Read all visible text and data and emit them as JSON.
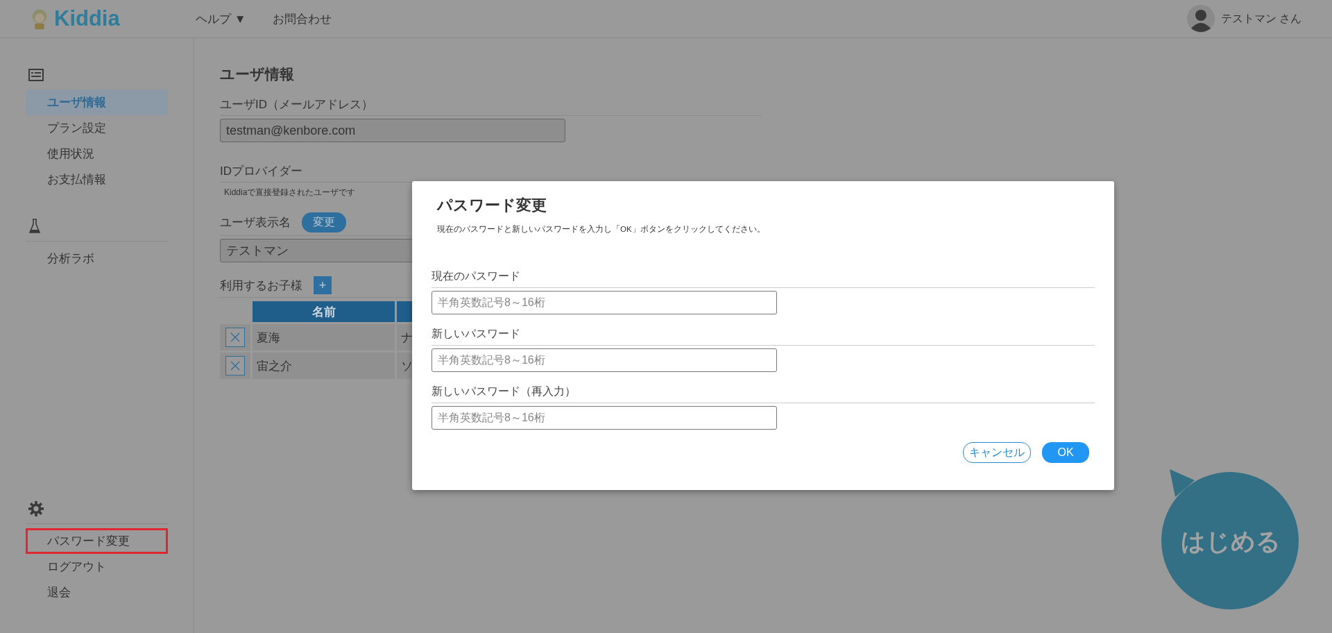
{
  "header": {
    "logo": "Kiddia",
    "nav": [
      {
        "label": "ヘルプ ▼"
      },
      {
        "label": "お問合わせ"
      }
    ],
    "user": "テストマン さん"
  },
  "sidebar": {
    "groups": [
      {
        "kind": "list",
        "items": [
          {
            "label": "ユーザ情報",
            "selected": true,
            "highlighted": false
          },
          {
            "label": "プラン設定",
            "selected": false,
            "highlighted": false
          },
          {
            "label": "使用状況",
            "selected": false,
            "highlighted": false
          },
          {
            "label": "お支払情報",
            "selected": false,
            "highlighted": false
          }
        ]
      },
      {
        "kind": "flask",
        "items": [
          {
            "label": "分析ラボ",
            "selected": false,
            "highlighted": false
          }
        ]
      },
      {
        "kind": "gear",
        "items": [
          {
            "label": "パスワード変更",
            "selected": false,
            "highlighted": true
          },
          {
            "label": "ログアウト",
            "selected": false,
            "highlighted": false
          },
          {
            "label": "退会",
            "selected": false,
            "highlighted": false
          }
        ]
      }
    ]
  },
  "main": {
    "title": "ユーザ情報",
    "user_id": {
      "label": "ユーザID（メールアドレス）",
      "value": "testman@kenbore.com"
    },
    "id_provider": {
      "label": "IDプロバイダー",
      "note": "Kiddiaで直接登録されたユーザです"
    },
    "display_name": {
      "label": "ユーザ表示名",
      "button": "変更",
      "value": "テストマン"
    },
    "children": {
      "label": "利用するお子様",
      "add_button": "+",
      "columns": [
        "名前"
      ],
      "rows": [
        {
          "name": "夏海",
          "column_2": "ナ"
        },
        {
          "name": "宙之介",
          "column_2": "ソ"
        }
      ]
    }
  },
  "modal": {
    "title": "パスワード変更",
    "description": "現在のパスワードと新しいパスワードを入力し「OK」ボタンをクリックしてください。",
    "fields": [
      {
        "label": "現在のパスワード",
        "placeholder": "半角英数記号8～16桁"
      },
      {
        "label": "新しいパスワード",
        "placeholder": "半角英数記号8～16桁"
      },
      {
        "label": "新しいパスワード（再入力）",
        "placeholder": "半角英数記号8～16桁"
      }
    ],
    "buttons": [
      {
        "label": "キャンセル",
        "kind": "secondary"
      },
      {
        "label": "OK",
        "kind": "primary"
      }
    ]
  },
  "start_bubble": {
    "label": "はじめる"
  }
}
